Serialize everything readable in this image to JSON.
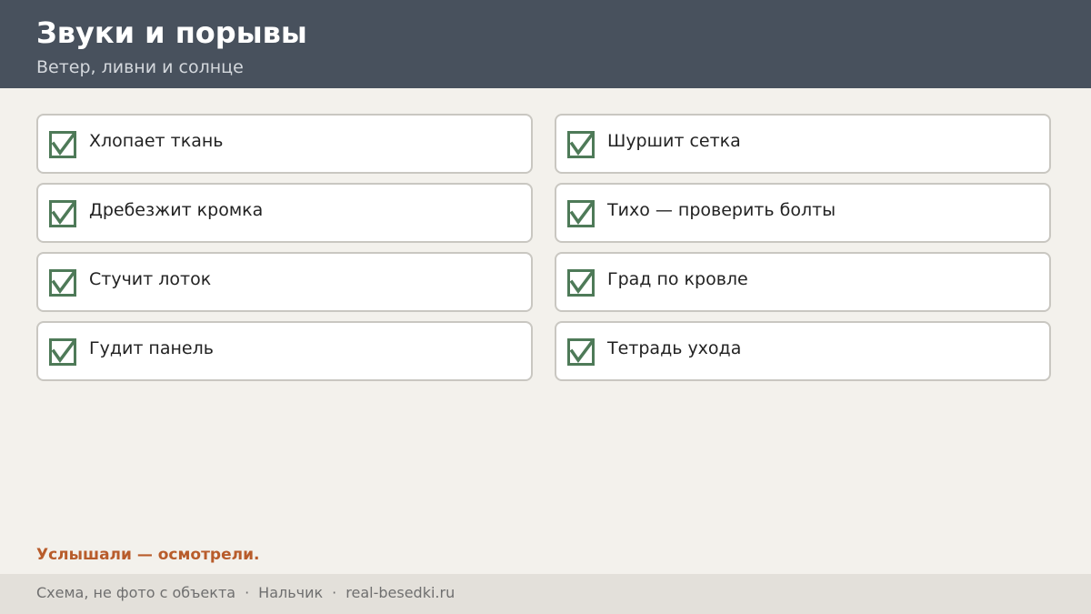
{
  "header": {
    "title": "Звуки и порывы",
    "subtitle": "Ветер, ливни и солнце"
  },
  "checklist": {
    "left": [
      {
        "label": "Хлопает ткань",
        "checked": true
      },
      {
        "label": "Дребезжит кромка",
        "checked": true
      },
      {
        "label": "Стучит лоток",
        "checked": true
      },
      {
        "label": "Гудит панель",
        "checked": true
      }
    ],
    "right": [
      {
        "label": "Шуршит сетка",
        "checked": true
      },
      {
        "label": "Тихо — проверить болты",
        "checked": true
      },
      {
        "label": "Град по кровле",
        "checked": true
      },
      {
        "label": "Тетрадь ухода",
        "checked": true
      }
    ]
  },
  "tagline": "Услышали — осмотрели.",
  "footer": {
    "note": "Схема, не фото с объекта",
    "separator": "·",
    "city": "Нальчик",
    "site": "real-besedki.ru"
  },
  "colors": {
    "header_bg": "#48515d",
    "accent": "#b85c2b",
    "checkbox": "#4e7a58"
  }
}
